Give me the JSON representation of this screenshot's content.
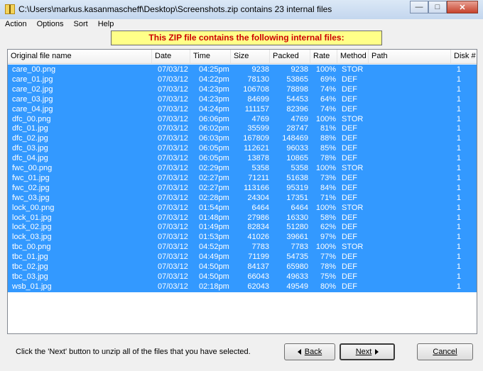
{
  "window": {
    "title": "C:\\Users\\markus.kasanmascheff\\Desktop\\Screenshots.zip contains 23 internal files"
  },
  "menu": [
    "Action",
    "Options",
    "Sort",
    "Help"
  ],
  "banner": "This ZIP file contains the following internal files:",
  "columns": [
    "Original file name",
    "Date",
    "Time",
    "Size",
    "Packed",
    "Rate",
    "Method",
    "Path",
    "Disk #"
  ],
  "files": [
    {
      "name": "care_00.png",
      "date": "07/03/12",
      "time": "04:25pm",
      "size": "9238",
      "packed": "9238",
      "rate": "100%",
      "method": "STOR",
      "path": "",
      "disk": "1"
    },
    {
      "name": "care_01.jpg",
      "date": "07/03/12",
      "time": "04:22pm",
      "size": "78130",
      "packed": "53865",
      "rate": "69%",
      "method": "DEF",
      "path": "",
      "disk": "1"
    },
    {
      "name": "care_02.jpg",
      "date": "07/03/12",
      "time": "04:23pm",
      "size": "106708",
      "packed": "78898",
      "rate": "74%",
      "method": "DEF",
      "path": "",
      "disk": "1"
    },
    {
      "name": "care_03.jpg",
      "date": "07/03/12",
      "time": "04:23pm",
      "size": "84699",
      "packed": "54453",
      "rate": "64%",
      "method": "DEF",
      "path": "",
      "disk": "1"
    },
    {
      "name": "care_04.jpg",
      "date": "07/03/12",
      "time": "04:24pm",
      "size": "111157",
      "packed": "82396",
      "rate": "74%",
      "method": "DEF",
      "path": "",
      "disk": "1"
    },
    {
      "name": "dfc_00.png",
      "date": "07/03/12",
      "time": "06:06pm",
      "size": "4769",
      "packed": "4769",
      "rate": "100%",
      "method": "STOR",
      "path": "",
      "disk": "1"
    },
    {
      "name": "dfc_01.jpg",
      "date": "07/03/12",
      "time": "06:02pm",
      "size": "35599",
      "packed": "28747",
      "rate": "81%",
      "method": "DEF",
      "path": "",
      "disk": "1"
    },
    {
      "name": "dfc_02.jpg",
      "date": "07/03/12",
      "time": "06:03pm",
      "size": "167809",
      "packed": "148469",
      "rate": "88%",
      "method": "DEF",
      "path": "",
      "disk": "1"
    },
    {
      "name": "dfc_03.jpg",
      "date": "07/03/12",
      "time": "06:05pm",
      "size": "112621",
      "packed": "96033",
      "rate": "85%",
      "method": "DEF",
      "path": "",
      "disk": "1"
    },
    {
      "name": "dfc_04.jpg",
      "date": "07/03/12",
      "time": "06:05pm",
      "size": "13878",
      "packed": "10865",
      "rate": "78%",
      "method": "DEF",
      "path": "",
      "disk": "1"
    },
    {
      "name": "fwc_00.png",
      "date": "07/03/12",
      "time": "02:29pm",
      "size": "5358",
      "packed": "5358",
      "rate": "100%",
      "method": "STOR",
      "path": "",
      "disk": "1"
    },
    {
      "name": "fwc_01.jpg",
      "date": "07/03/12",
      "time": "02:27pm",
      "size": "71211",
      "packed": "51638",
      "rate": "73%",
      "method": "DEF",
      "path": "",
      "disk": "1"
    },
    {
      "name": "fwc_02.jpg",
      "date": "07/03/12",
      "time": "02:27pm",
      "size": "113166",
      "packed": "95319",
      "rate": "84%",
      "method": "DEF",
      "path": "",
      "disk": "1"
    },
    {
      "name": "fwc_03.jpg",
      "date": "07/03/12",
      "time": "02:28pm",
      "size": "24304",
      "packed": "17351",
      "rate": "71%",
      "method": "DEF",
      "path": "",
      "disk": "1"
    },
    {
      "name": "lock_00.png",
      "date": "07/03/12",
      "time": "01:54pm",
      "size": "6464",
      "packed": "6464",
      "rate": "100%",
      "method": "STOR",
      "path": "",
      "disk": "1"
    },
    {
      "name": "lock_01.jpg",
      "date": "07/03/12",
      "time": "01:48pm",
      "size": "27986",
      "packed": "16330",
      "rate": "58%",
      "method": "DEF",
      "path": "",
      "disk": "1"
    },
    {
      "name": "lock_02.jpg",
      "date": "07/03/12",
      "time": "01:49pm",
      "size": "82834",
      "packed": "51280",
      "rate": "62%",
      "method": "DEF",
      "path": "",
      "disk": "1"
    },
    {
      "name": "lock_03.jpg",
      "date": "07/03/12",
      "time": "01:53pm",
      "size": "41026",
      "packed": "39661",
      "rate": "97%",
      "method": "DEF",
      "path": "",
      "disk": "1"
    },
    {
      "name": "tbc_00.png",
      "date": "07/03/12",
      "time": "04:52pm",
      "size": "7783",
      "packed": "7783",
      "rate": "100%",
      "method": "STOR",
      "path": "",
      "disk": "1"
    },
    {
      "name": "tbc_01.jpg",
      "date": "07/03/12",
      "time": "04:49pm",
      "size": "71199",
      "packed": "54735",
      "rate": "77%",
      "method": "DEF",
      "path": "",
      "disk": "1"
    },
    {
      "name": "tbc_02.jpg",
      "date": "07/03/12",
      "time": "04:50pm",
      "size": "84137",
      "packed": "65980",
      "rate": "78%",
      "method": "DEF",
      "path": "",
      "disk": "1"
    },
    {
      "name": "tbc_03.jpg",
      "date": "07/03/12",
      "time": "04:50pm",
      "size": "66043",
      "packed": "49633",
      "rate": "75%",
      "method": "DEF",
      "path": "",
      "disk": "1"
    },
    {
      "name": "wsb_01.jpg",
      "date": "07/03/12",
      "time": "02:18pm",
      "size": "62043",
      "packed": "49549",
      "rate": "80%",
      "method": "DEF",
      "path": "",
      "disk": "1"
    }
  ],
  "footer": {
    "hint": "Click the 'Next' button to unzip all of the files that you have selected.",
    "back_label": "Back",
    "next_label": "Next",
    "cancel_label": "Cancel"
  },
  "colors": {
    "selection": "#3399ff",
    "banner_bg": "#ffff88",
    "banner_text": "#cc0000"
  }
}
